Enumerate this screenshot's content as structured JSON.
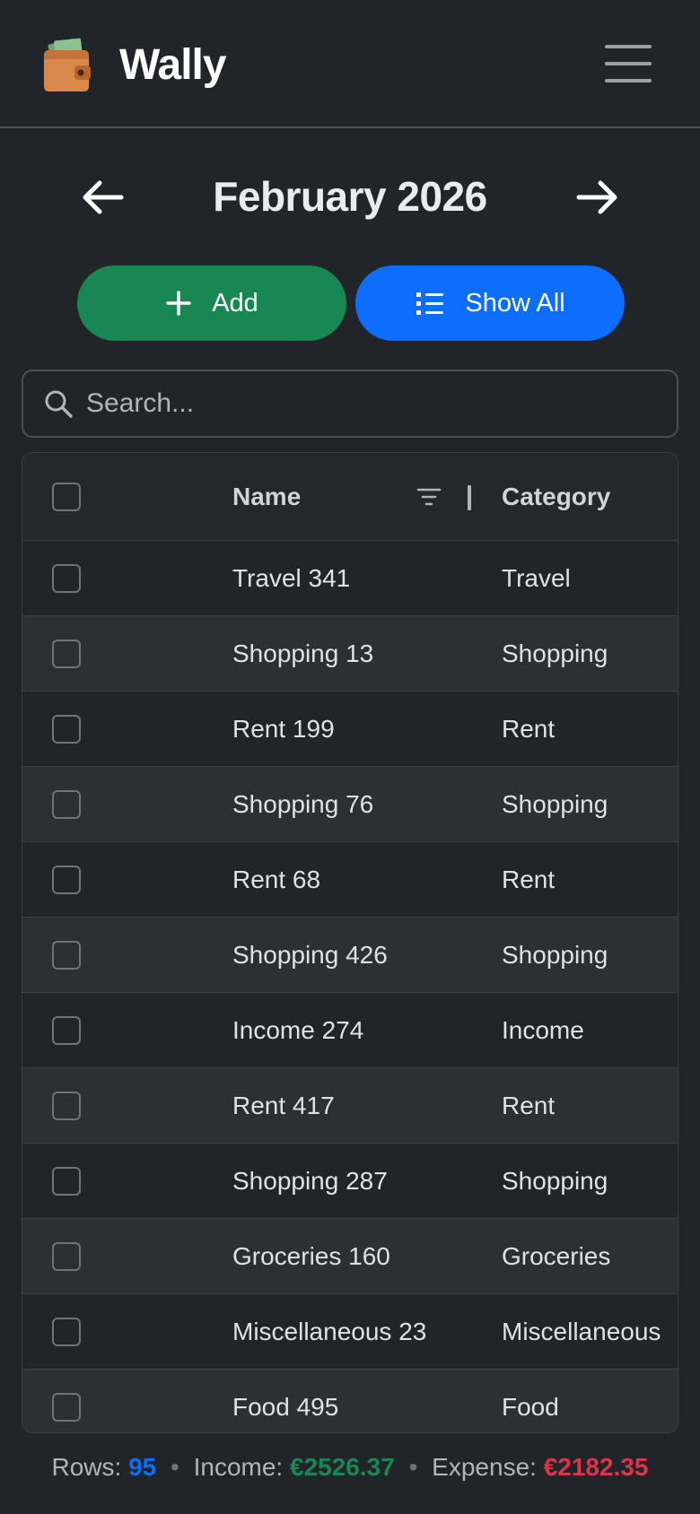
{
  "app": {
    "title": "Wally"
  },
  "month_nav": {
    "title": "February 2026",
    "prev_icon": "arrow-left-icon",
    "next_icon": "arrow-right-icon"
  },
  "actions": {
    "add_label": "Add",
    "show_all_label": "Show All"
  },
  "search": {
    "placeholder": "Search..."
  },
  "table": {
    "headers": {
      "name": "Name",
      "category": "Category"
    },
    "rows": [
      {
        "name": "Travel 341",
        "category": "Travel"
      },
      {
        "name": "Shopping 13",
        "category": "Shopping"
      },
      {
        "name": "Rent 199",
        "category": "Rent"
      },
      {
        "name": "Shopping 76",
        "category": "Shopping"
      },
      {
        "name": "Rent 68",
        "category": "Rent"
      },
      {
        "name": "Shopping 426",
        "category": "Shopping"
      },
      {
        "name": "Income 274",
        "category": "Income"
      },
      {
        "name": "Rent 417",
        "category": "Rent"
      },
      {
        "name": "Shopping 287",
        "category": "Shopping"
      },
      {
        "name": "Groceries 160",
        "category": "Groceries"
      },
      {
        "name": "Miscellaneous 23",
        "category": "Miscellaneous"
      },
      {
        "name": "Food 495",
        "category": "Food"
      }
    ]
  },
  "footer": {
    "rows_label": "Rows:",
    "rows_value": "95",
    "income_label": "Income:",
    "income_value": "€2526.37",
    "expense_label": "Expense:",
    "expense_value": "€2182.35",
    "separator": "•"
  },
  "colors": {
    "background": "#212529",
    "add": "#198754",
    "show_all": "#0d6efd",
    "expense": "#dc3545"
  }
}
